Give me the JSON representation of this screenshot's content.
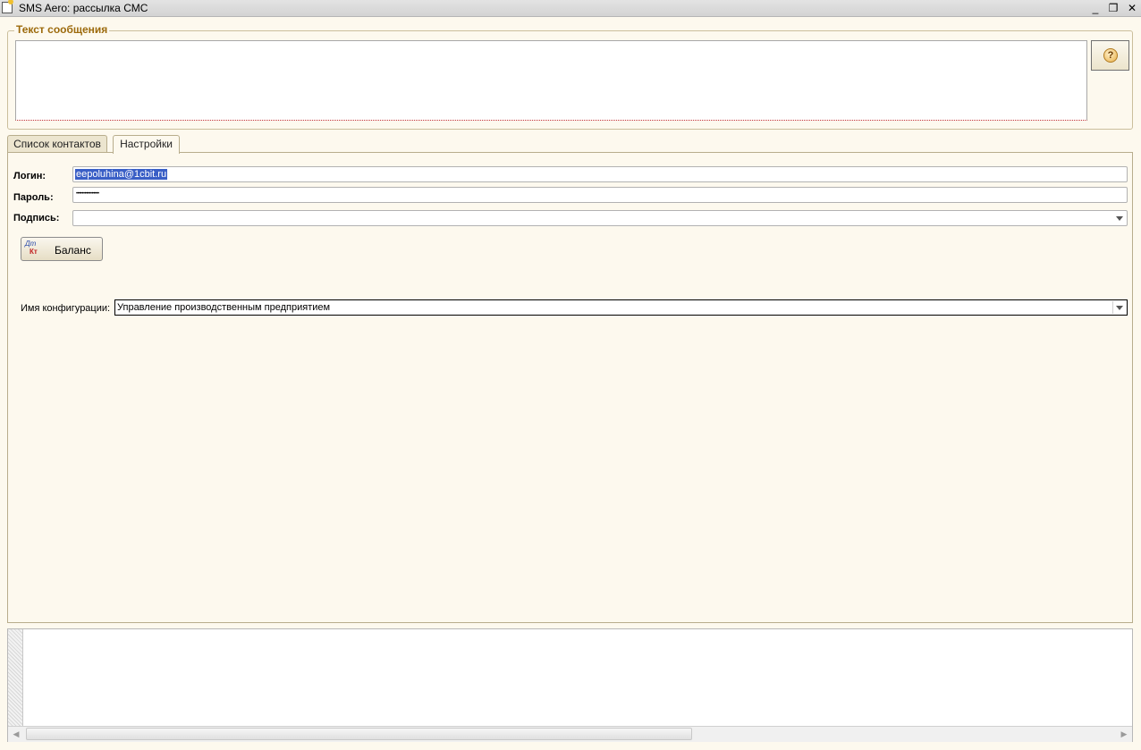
{
  "window": {
    "title": "SMS Aero: рассылка СМС",
    "minimize_glyph": "_",
    "restore_glyph": "❐",
    "close_glyph": "✕"
  },
  "message_group": {
    "title": "Текст сообщения",
    "text_value": "",
    "help_glyph": "?"
  },
  "tabs": [
    {
      "label": "Список контактов",
      "active": false
    },
    {
      "label": "Настройки",
      "active": true
    }
  ],
  "settings": {
    "login_label": "Логин:",
    "login_value": "eepoluhina@1cbit.ru",
    "password_label": "Пароль:",
    "password_value": "••••••••••••••••",
    "signature_label": "Подпись:",
    "signature_value": "",
    "balance_button": "Баланс",
    "balance_icon_top": "Дт",
    "balance_icon_bottom": "Кт",
    "config_label": "Имя конфигурации:",
    "config_value": "Управление производственным предприятием"
  },
  "scrollbar": {
    "left_arrow": "◀",
    "right_arrow": "▶"
  }
}
